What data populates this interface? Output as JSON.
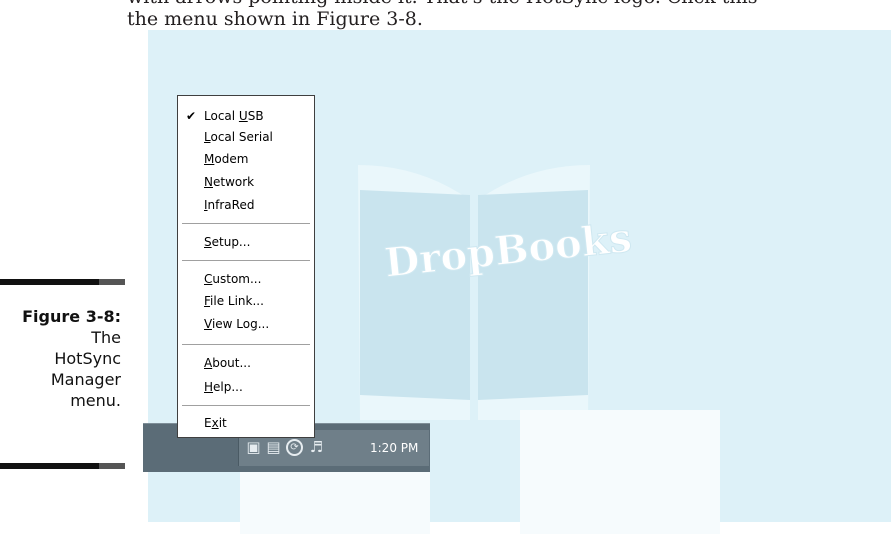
{
  "body_text": {
    "line1": "with arrows pointing inside it. That's the HotSync logo. Click this",
    "line2": "the menu shown in Figure 3-8."
  },
  "watermark_text": "DropBooks",
  "caption": {
    "label": "Figure 3-8:",
    "line1": "The",
    "line2": "HotSync",
    "line3": "Manager",
    "line4": "menu."
  },
  "menu": {
    "checked_item": "Local USB",
    "items": [
      {
        "pre": "Local ",
        "u": "U",
        "post": "SB"
      },
      {
        "pre": "",
        "u": "L",
        "post": "ocal Serial"
      },
      {
        "pre": "",
        "u": "M",
        "post": "odem"
      },
      {
        "pre": "",
        "u": "N",
        "post": "etwork"
      },
      {
        "pre": "",
        "u": "I",
        "post": "nfraRed"
      },
      {
        "pre": "",
        "u": "S",
        "post": "etup..."
      },
      {
        "pre": "",
        "u": "C",
        "post": "ustom..."
      },
      {
        "pre": "",
        "u": "F",
        "post": "ile Link..."
      },
      {
        "pre": "",
        "u": "V",
        "post": "iew Log..."
      },
      {
        "pre": "",
        "u": "A",
        "post": "bout..."
      },
      {
        "pre": "",
        "u": "H",
        "post": "elp..."
      },
      {
        "pre": "E",
        "u": "x",
        "post": "it"
      }
    ]
  },
  "taskbar": {
    "clock": "1:20 PM",
    "tray_icons": [
      "network-icon",
      "network-activity-icon",
      "hotsync-icon",
      "speaker-icon"
    ]
  },
  "colors": {
    "watermark_fill": "#d7eef6",
    "taskbar": "#5b6c77",
    "menu_border": "#3f3f3f"
  }
}
